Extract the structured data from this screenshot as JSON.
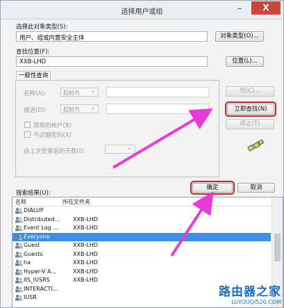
{
  "window": {
    "title": "选择用户或组",
    "close_label": "X"
  },
  "object_type": {
    "label": "选择此对象类型(S):",
    "value": "用户、组或内置安全主体",
    "button": "对象类型(O)..."
  },
  "location": {
    "label": "查找位置(F):",
    "value": "XXB-LHD",
    "button": "位置(L)..."
  },
  "query": {
    "tab": "一般性查询",
    "name_label": "名称(A):",
    "desc_label": "描述(D):",
    "match_option": "起始为",
    "disabled_accounts": "禁用的帐户(B)",
    "no_expire_password": "不过期密码(X)",
    "days_since_logon": "自上次登录后的天数(I):"
  },
  "side_buttons": {
    "columns": "列(C)...",
    "find_now": "立即查找(N)",
    "stop": "停止(T)"
  },
  "footer": {
    "ok": "确定",
    "cancel": "取消"
  },
  "results": {
    "label": "搜索结果(U):",
    "columns": [
      "名称",
      "所在文件夹"
    ],
    "rows": [
      {
        "name": "DIALUP",
        "folder": ""
      },
      {
        "name": "Distributed...",
        "folder": "XXB-LHD"
      },
      {
        "name": "Event Log ...",
        "folder": "XXB-LHD"
      },
      {
        "name": "Everyone",
        "folder": ""
      },
      {
        "name": "Guest",
        "folder": "XXB-LHD"
      },
      {
        "name": "Guests",
        "folder": "XXB-LHD"
      },
      {
        "name": "ha",
        "folder": "XXB-LHD"
      },
      {
        "name": "Hyper-V A...",
        "folder": "XXB-LHD"
      },
      {
        "name": "IIS_IUSRS",
        "folder": "XXB-LHD"
      },
      {
        "name": "INTERACTI...",
        "folder": ""
      },
      {
        "name": "IUSR",
        "folder": ""
      }
    ],
    "selected_index": 3
  },
  "watermark": {
    "title": "路由器之家",
    "url": "LUYOUQI520.COM"
  },
  "colors": {
    "annotation": "#e83ad8",
    "highlight": "#c0282c",
    "selection": "#3a8ee6",
    "brand": "#1b6fc0"
  }
}
